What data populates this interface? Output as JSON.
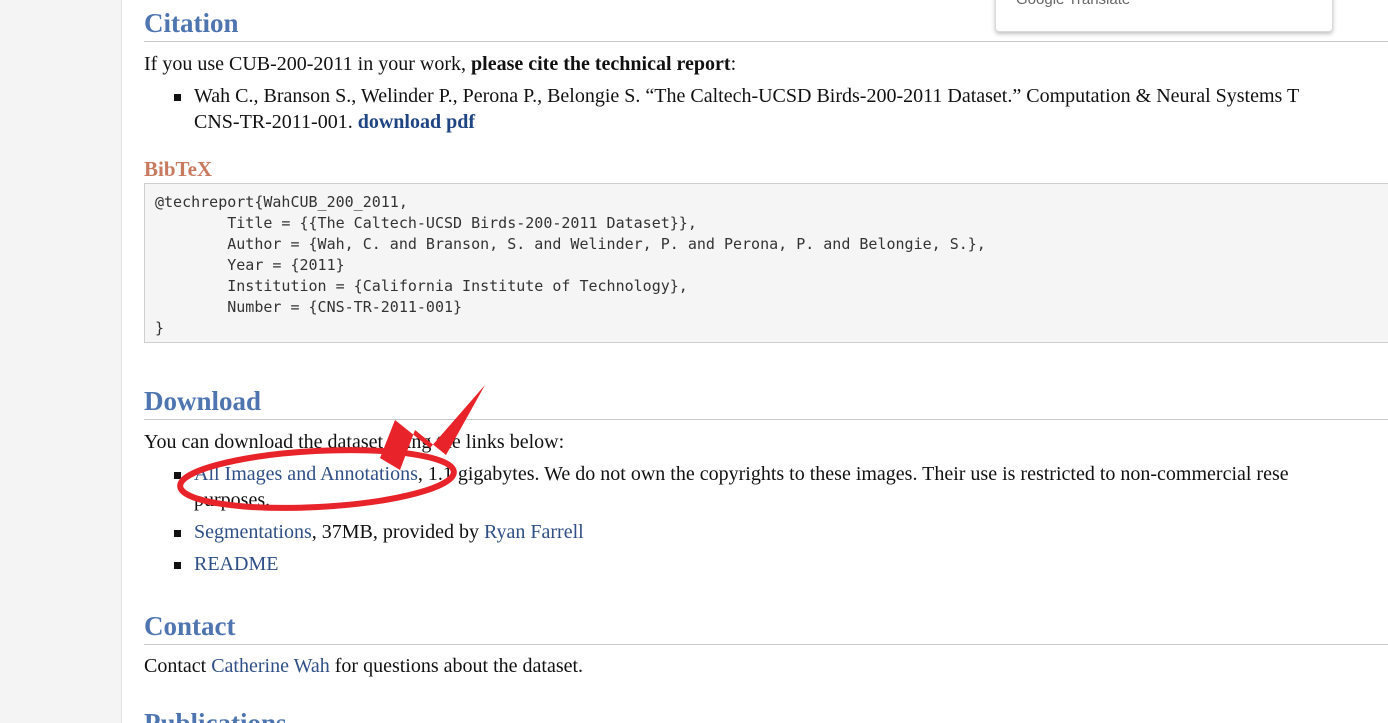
{
  "popup": {
    "text": "Google Translate"
  },
  "citation": {
    "heading": "Citation",
    "intro_prefix": "If you use CUB-200-2011 in your work, ",
    "intro_bold": "please cite the technical report",
    "intro_suffix": ":",
    "reference_line1": "Wah C., Branson S., Welinder P., Perona P., Belongie S. “The Caltech-UCSD Birds-200-2011 Dataset.” Computation & Neural Systems T",
    "reference_line2": "CNS-TR-2011-001. ",
    "download_pdf": "download pdf"
  },
  "bibtex": {
    "heading": "BibTeX",
    "code": "@techreport{WahCUB_200_2011,\n\tTitle = {{The Caltech-UCSD Birds-200-2011 Dataset}},\n\tAuthor = {Wah, C. and Branson, S. and Welinder, P. and Perona, P. and Belongie, S.},\n\tYear = {2011}\n\tInstitution = {California Institute of Technology},\n\tNumber = {CNS-TR-2011-001}\n}"
  },
  "download": {
    "heading": "Download",
    "intro": "You can download the dataset using the links below:",
    "items": [
      {
        "link": "All Images and Annotations",
        "text_line1": ", 1.1 gigabytes. We do not own the copyrights to these images. Their use is restricted to non-commercial rese",
        "text_line2": "purposes."
      },
      {
        "link": "Segmentations",
        "text": ", 37MB, provided by ",
        "link2": "Ryan Farrell"
      },
      {
        "link": "README"
      }
    ]
  },
  "contact": {
    "heading": "Contact",
    "prefix": "Contact ",
    "link": "Catherine Wah",
    "suffix": " for questions about the dataset."
  },
  "next_section": {
    "heading": "Publications"
  },
  "colors": {
    "heading": "#4f75b0",
    "link": "#2f4f86",
    "bibtex": "#c87a60",
    "annotation": "#e8232a"
  }
}
